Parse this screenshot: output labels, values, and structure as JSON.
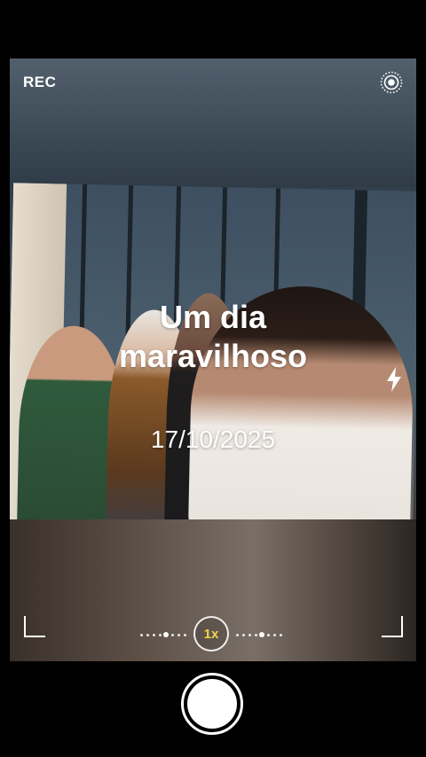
{
  "status": {
    "rec_label": "REC"
  },
  "overlay": {
    "title_line1": "Um dia",
    "title_line2": "maravilhoso",
    "date": "17/10/2025"
  },
  "zoom": {
    "label": "1x"
  },
  "icons": {
    "live_photo": "live-photo-icon",
    "flash": "flash-icon",
    "shutter": "shutter-button"
  },
  "colors": {
    "zoom_accent": "#f3d34a",
    "background": "#000000"
  }
}
